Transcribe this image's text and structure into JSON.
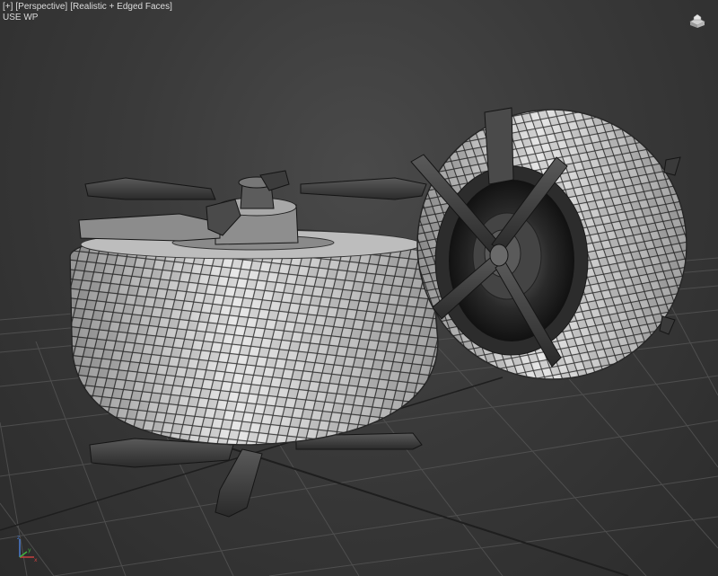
{
  "viewport": {
    "labels": {
      "plus_menu": "[+]",
      "view_menu": "[Perspective]",
      "shading_menu": "[Realistic + Edged Faces]"
    },
    "sub_label": "USE WP"
  },
  "tripod": {
    "x": "x",
    "y": "y",
    "z": "z"
  },
  "colors": {
    "background": "#3a3a3a",
    "grid": "#5a5a5a",
    "mesh_fill": "#d8d8d8",
    "mesh_edge": "#2a2a2a"
  }
}
